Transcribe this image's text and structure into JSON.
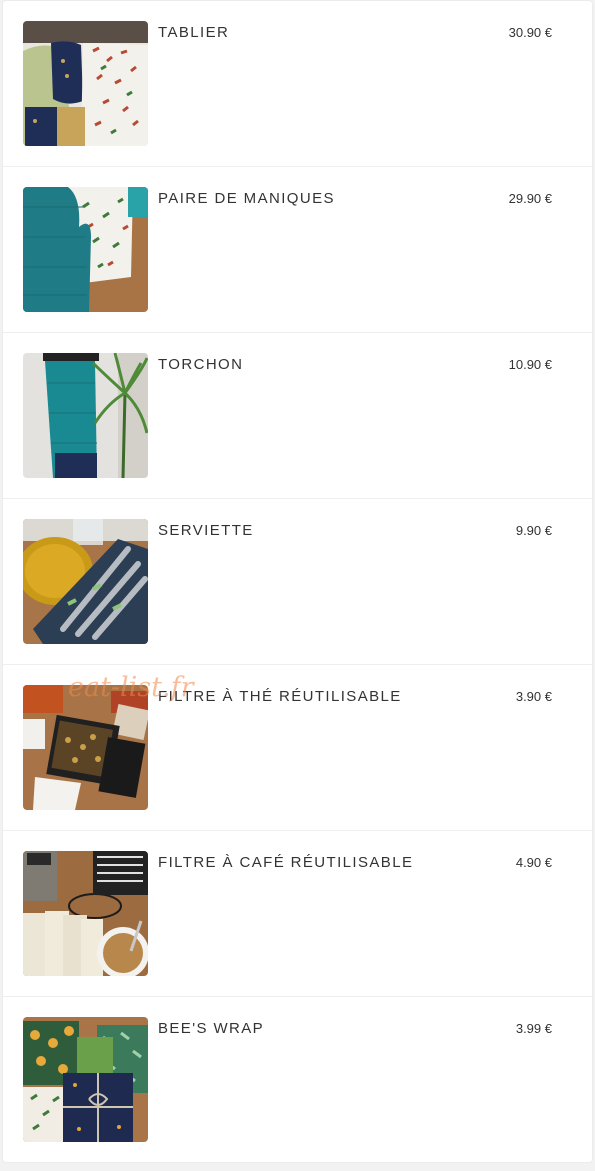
{
  "products": [
    {
      "name": "TABLIER",
      "price": "30.90 €",
      "image": "apron-photo"
    },
    {
      "name": "PAIRE DE MANIQUES",
      "price": "29.90 €",
      "image": "oven-mitts-photo"
    },
    {
      "name": "TORCHON",
      "price": "10.90 €",
      "image": "tea-towel-photo"
    },
    {
      "name": "SERVIETTE",
      "price": "9.90 €",
      "image": "napkin-photo"
    },
    {
      "name": "FILTRE À THÉ RÉUTILISABLE",
      "price": "3.90 €",
      "image": "tea-filter-photo"
    },
    {
      "name": "FILTRE À CAFÉ RÉUTILISABLE",
      "price": "4.90 €",
      "image": "coffee-filter-photo"
    },
    {
      "name": "BEE'S WRAP",
      "price": "3.99 €",
      "image": "bees-wrap-photo"
    }
  ],
  "watermark": "eat-list.fr"
}
